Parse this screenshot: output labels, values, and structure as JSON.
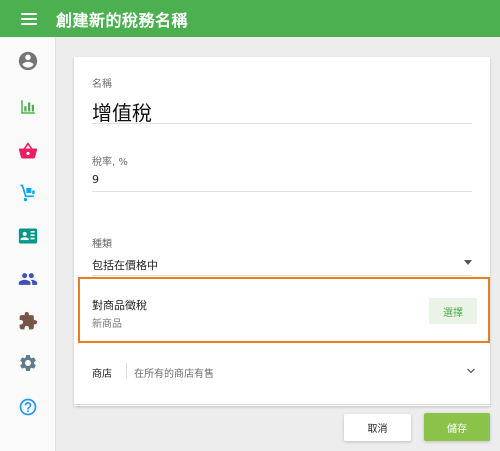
{
  "appbar": {
    "title": "創建新的稅務名稱",
    "color": "#4caf50"
  },
  "sidebar": {
    "items": [
      {
        "icon": "account-circle-icon",
        "color": "#757575"
      },
      {
        "icon": "bar-chart-icon",
        "color": "#4caf50"
      },
      {
        "icon": "shopping-basket-icon",
        "color": "#e91e63"
      },
      {
        "icon": "hand-truck-icon",
        "color": "#03a9f4"
      },
      {
        "icon": "contact-card-icon",
        "color": "#009688"
      },
      {
        "icon": "people-icon",
        "color": "#3f51b5"
      },
      {
        "icon": "puzzle-icon",
        "color": "#795548"
      },
      {
        "icon": "settings-gear-icon",
        "color": "#607d8b"
      },
      {
        "icon": "help-circle-icon",
        "color": "#2196f3"
      }
    ]
  },
  "form": {
    "name": {
      "label": "名稱",
      "value": "增值稅"
    },
    "rate": {
      "label": "稅率, %",
      "value": "9"
    },
    "type": {
      "label": "種類",
      "value": "包括在價格中"
    },
    "apply_to": {
      "title": "對商品徵稅",
      "subtitle": "新商品",
      "button": "選擇"
    },
    "store": {
      "label": "商店",
      "value": "在所有的商店有售"
    }
  },
  "actions": {
    "cancel": "取消",
    "save": "儲存"
  },
  "colors": {
    "accent": "#4caf50",
    "save_button": "#8bc34a",
    "highlight_border": "#e67e22"
  }
}
